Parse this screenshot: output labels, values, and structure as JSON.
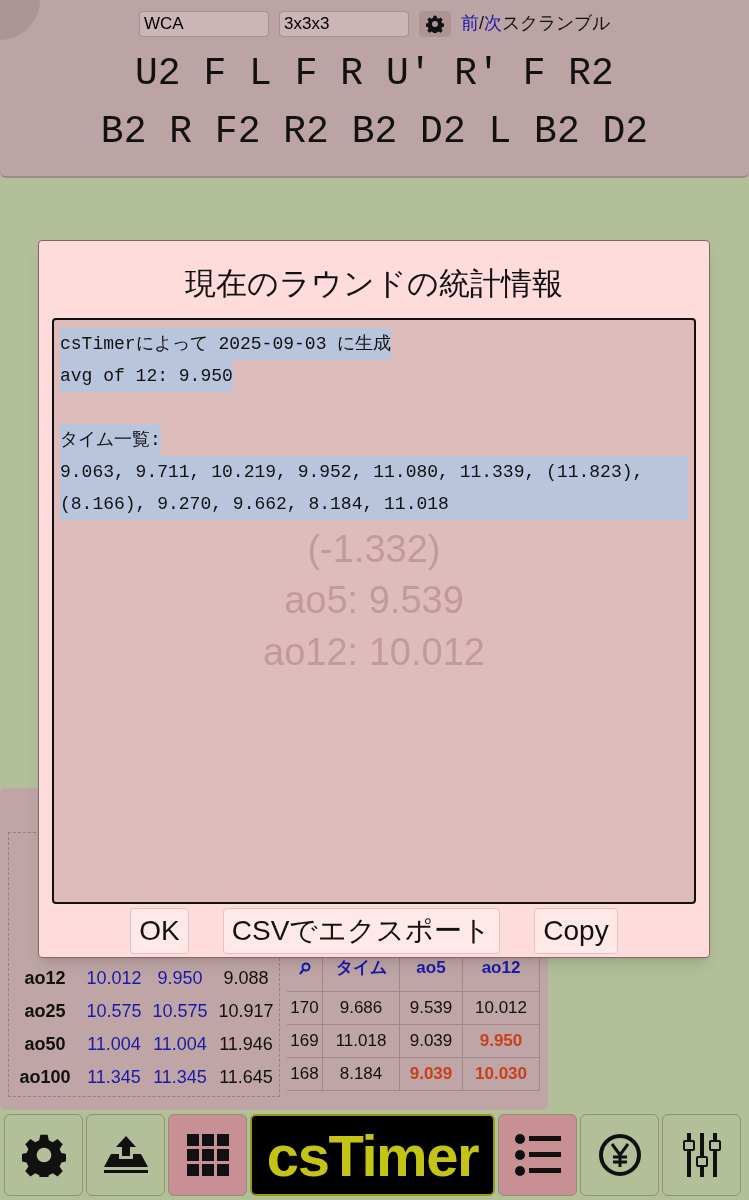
{
  "scramble_bar": {
    "scramble_type": "WCA",
    "puzzle": "3x3x3",
    "prev_link": "前",
    "separator": "/",
    "next_link": "次",
    "scramble_label": "スクランブル",
    "lines": [
      "U2 F L F R U' R' F R2",
      "B2 R F2 R2 B2 D2 L B2 D2"
    ]
  },
  "background_timer": {
    "diff": "(-1.332)",
    "ao5": "ao5: 9.539",
    "ao12": "ao12: 10.012"
  },
  "dialog": {
    "title": "現在のラウンドの統計情報",
    "paragraphs": [
      [
        "csTimerによって 2025-09-03 に生成",
        "avg of 12: 9.950"
      ],
      [
        "タイム一覧:",
        "9.063, 9.711, 10.219, 9.952, 11.080, 11.339, (11.823), (8.166), 9.270, 9.662, 8.184, 11.018"
      ]
    ],
    "buttons": [
      "OK",
      "CSVでエクスポート",
      "Copy"
    ]
  },
  "stats": {
    "rows": [
      {
        "label": "ao12",
        "values": [
          "10.012",
          "9.950",
          "9.088"
        ]
      },
      {
        "label": "ao25",
        "values": [
          "10.575",
          "10.575",
          "10.917"
        ]
      },
      {
        "label": "ao50",
        "values": [
          "11.004",
          "11.004",
          "11.946"
        ]
      },
      {
        "label": "ao100",
        "values": [
          "11.345",
          "11.345",
          "11.645"
        ]
      }
    ]
  },
  "times_table": {
    "columns": [
      {
        "kind": "icon"
      },
      {
        "kind": "text",
        "label": "タイム"
      },
      {
        "kind": "text",
        "label": "ao5"
      },
      {
        "kind": "text",
        "label": "ao12"
      }
    ],
    "rows": [
      {
        "cells": [
          {
            "text": "170",
            "best": false
          },
          {
            "text": "9.686",
            "best": false
          },
          {
            "text": "9.539",
            "best": false
          },
          {
            "text": "10.012",
            "best": false
          }
        ]
      },
      {
        "cells": [
          {
            "text": "169",
            "best": false
          },
          {
            "text": "11.018",
            "best": false
          },
          {
            "text": "9.039",
            "best": false
          },
          {
            "text": "9.950",
            "best": true
          }
        ]
      },
      {
        "cells": [
          {
            "text": "168",
            "best": false
          },
          {
            "text": "8.184",
            "best": false
          },
          {
            "text": "9.039",
            "best": true
          },
          {
            "text": "10.030",
            "best": true
          }
        ]
      }
    ]
  },
  "toolbar": [
    {
      "kind": "settings",
      "selected": false
    },
    {
      "kind": "export",
      "selected": false
    },
    {
      "kind": "scramble",
      "selected": true
    },
    {
      "kind": "logo",
      "label": "csTimer"
    },
    {
      "kind": "stats",
      "selected": true
    },
    {
      "kind": "donate",
      "selected": false
    },
    {
      "kind": "tools",
      "selected": false
    }
  ]
}
